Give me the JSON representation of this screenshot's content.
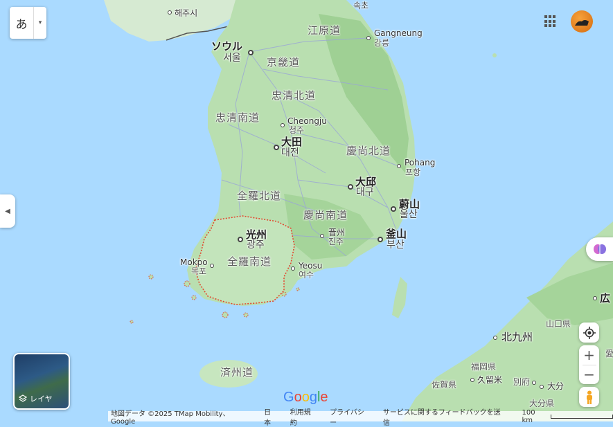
{
  "language_button": {
    "glyph": "あ",
    "caret": "▾"
  },
  "labels": {
    "haeju": "해주시",
    "seoul_ja": "ソウル",
    "seoul_ko": "서울",
    "sokcho": "속초",
    "gangwon": "江原道",
    "gangneung": "Gangneung",
    "gangneung_ko": "강릉",
    "gyeonggi": "京畿道",
    "chungbuk": "忠清北道",
    "chungnam": "忠清南道",
    "cheongju": "Cheongju",
    "cheongju_ko": "청주",
    "daejeon_ja": "大田",
    "daejeon_ko": "대전",
    "gyeongbuk": "慶尚北道",
    "pohang": "Pohang",
    "pohang_ko": "포항",
    "daegu_ja": "大邱",
    "daegu_ko": "대구",
    "jeonbuk": "全羅北道",
    "ulsan_ja": "蔚山",
    "ulsan_ko": "울산",
    "gyeongnam": "慶尚南道",
    "gwangju_ja": "光州",
    "gwangju_ko": "광주",
    "jinju_ja": "晋州",
    "jinju_ko": "진주",
    "busan_ja": "釜山",
    "busan_ko": "부산",
    "mokpo": "Mokpo",
    "mokpo_ko": "목포",
    "jeonnam": "全羅南道",
    "yeosu": "Yeosu",
    "yeosu_ko": "여수",
    "jeju": "済州道",
    "hiroshima": "広",
    "yamaguchi": "山口県",
    "kitakyushu": "北九州",
    "fukuoka": "福岡県",
    "kurume": "久留米",
    "saga": "佐賀県",
    "beppu": "別府",
    "oita": "大分",
    "oita_pref": "大分県",
    "ai": "愛"
  },
  "layers_button": {
    "label": "レイヤ"
  },
  "google_logo": [
    "G",
    "o",
    "o",
    "g",
    "l",
    "e"
  ],
  "footer": {
    "attribution": "地図データ ©2025 TMap Mobility、Google",
    "country": "日本",
    "terms": "利用規約",
    "privacy": "プライバシー",
    "feedback": "サービスに関するフィードバックを送信",
    "scale": "100 km"
  },
  "colors": {
    "sea": "#aadaff",
    "land": "#c8e6c0",
    "forest": "#a8d5a2",
    "roads": "#8f9fcf",
    "highlight_border": "#e2482f"
  }
}
